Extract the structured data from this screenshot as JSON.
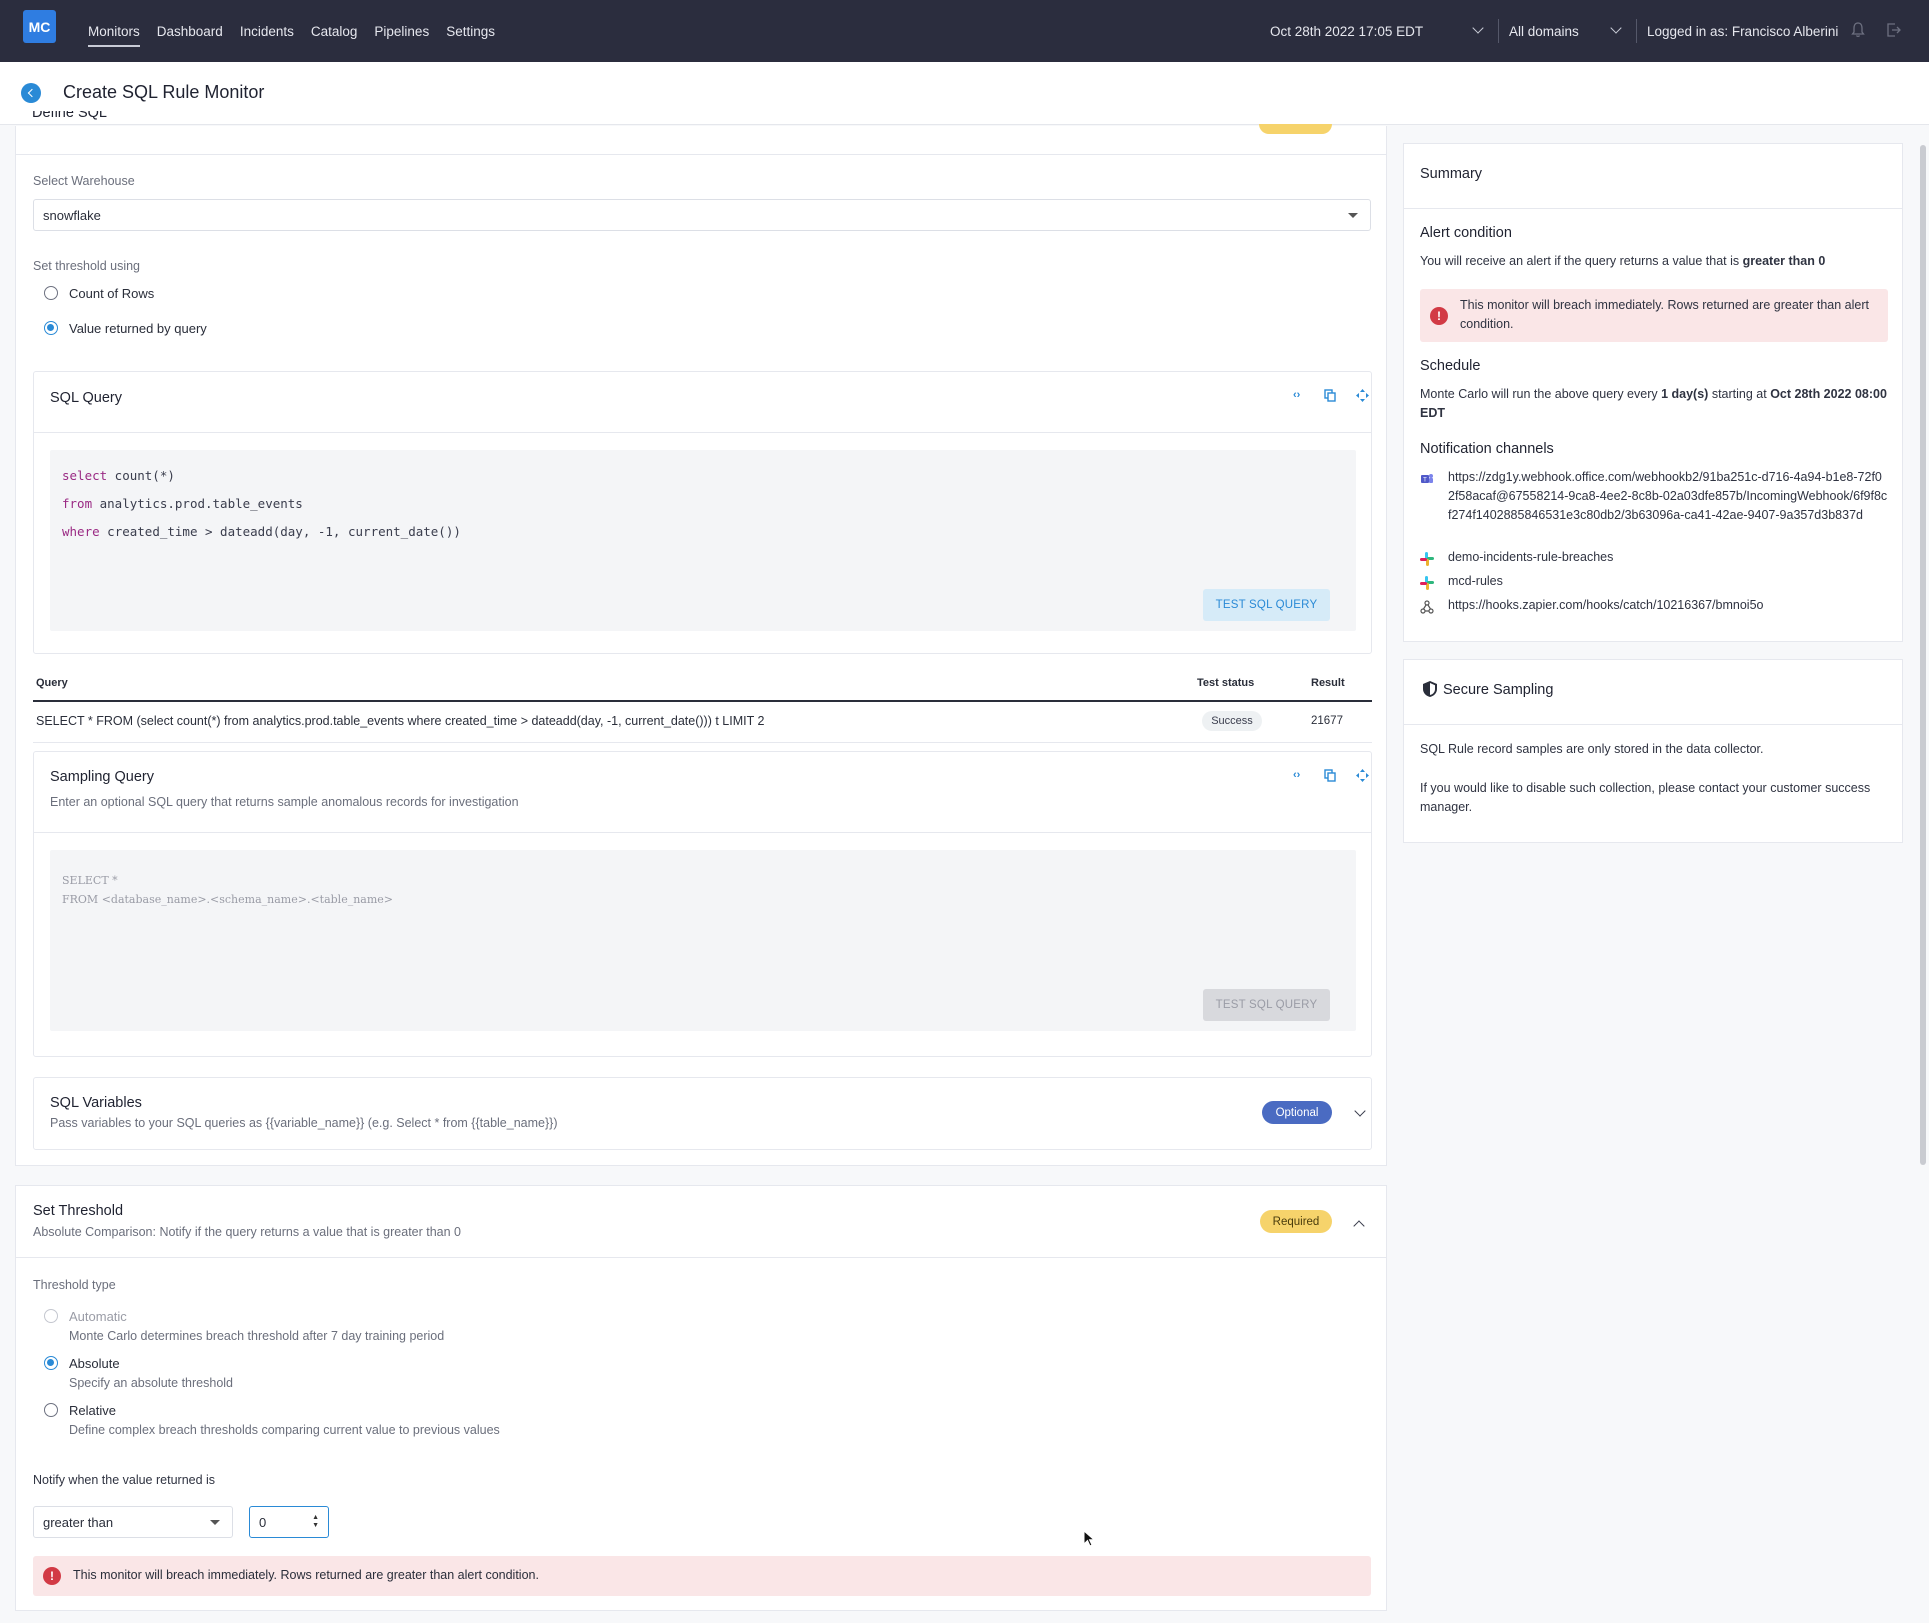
{
  "nav": {
    "logo": "MC",
    "links": [
      "Monitors",
      "Dashboard",
      "Incidents",
      "Catalog",
      "Pipelines",
      "Settings"
    ],
    "datetime": "Oct 28th 2022 17:05 EDT",
    "domains": "All domains",
    "user": "Logged in as: Francisco Alberini"
  },
  "header": {
    "title": "Create SQL Rule Monitor"
  },
  "define": {
    "title": "Define SQL",
    "badge": "Required",
    "warehouse_label": "Select Warehouse",
    "warehouse_value": "snowflake",
    "threshold_label": "Set threshold using",
    "options": [
      "Count of Rows",
      "Value returned by query"
    ]
  },
  "sql_query": {
    "title": "SQL Query",
    "line1_kw": "select",
    "line1_rest": " count(*)",
    "line2_kw": "from",
    "line2_rest": "  analytics.prod.table_events",
    "line3_kw": "where",
    "line3_rest": " created_time > dateadd(day, -1, current_date())",
    "test_button": "TEST SQL QUERY"
  },
  "results": {
    "headers": [
      "Query",
      "Test status",
      "Result"
    ],
    "row": {
      "query": "SELECT * FROM (select count(*) from analytics.prod.table_events where created_time > dateadd(day, -1, current_date())) t LIMIT 2",
      "status": "Success",
      "result": "21677"
    }
  },
  "sampling": {
    "title": "Sampling Query",
    "subtitle": "Enter an optional SQL query that returns sample anomalous records for investigation",
    "placeholder_line1": "SELECT *",
    "placeholder_line2": "FROM <database_name>.<schema_name>.<table_name>",
    "test_button": "TEST SQL QUERY"
  },
  "variables": {
    "title": "SQL Variables",
    "subtitle": "Pass variables to your SQL queries as {{variable_name}} (e.g. Select * from {{table_name}})",
    "badge": "Optional"
  },
  "threshold": {
    "title": "Set Threshold",
    "subtitle": "Absolute Comparison: Notify if the query returns a value that is greater than 0",
    "badge": "Required",
    "type_label": "Threshold type",
    "options": [
      {
        "label": "Automatic",
        "desc": "Monte Carlo determines breach threshold after 7 day training period"
      },
      {
        "label": "Absolute",
        "desc": "Specify an absolute threshold"
      },
      {
        "label": "Relative",
        "desc": "Define complex breach thresholds comparing current value to previous values"
      }
    ],
    "notify_label": "Notify when the value returned is",
    "operator": "greater than",
    "value": "0",
    "alert": "This monitor will breach immediately. Rows returned are greater than alert condition."
  },
  "summary": {
    "title": "Summary",
    "alert_h": "Alert condition",
    "alert_text_pre": "You will receive an alert if the query returns a value that is ",
    "alert_text_bold": "greater than 0",
    "alert_box": "This monitor will breach immediately. Rows returned are greater than alert condition.",
    "schedule_h": "Schedule",
    "schedule_pre": "Monte Carlo will run the above query every ",
    "schedule_every": "1 day(s)",
    "schedule_mid": " starting at ",
    "schedule_start": "Oct 28th 2022 08:00 EDT",
    "channels_h": "Notification channels",
    "channels": [
      {
        "icon": "teams-icon",
        "text": "https://zdg1y.webhook.office.com/webhookb2/91ba251c-d716-4a94-b1e8-72f02f58acaf@67558214-9ca8-4ee2-8c8b-02a03dfe857b/IncomingWebhook/6f9f8cf274f1402885846531e3c80db2/3b63096a-ca41-42ae-9407-9a357d3b837d"
      },
      {
        "icon": "slack-icon",
        "text": "demo-incidents-rule-breaches"
      },
      {
        "icon": "slack-icon",
        "text": "mcd-rules"
      },
      {
        "icon": "webhook-icon",
        "text": "https://hooks.zapier.com/hooks/catch/10216367/bmnoi5o"
      }
    ]
  },
  "secure": {
    "title": "Secure Sampling",
    "p1": "SQL Rule record samples are only stored in the data collector.",
    "p2": "If you would like to disable such collection, please contact your customer success manager."
  }
}
